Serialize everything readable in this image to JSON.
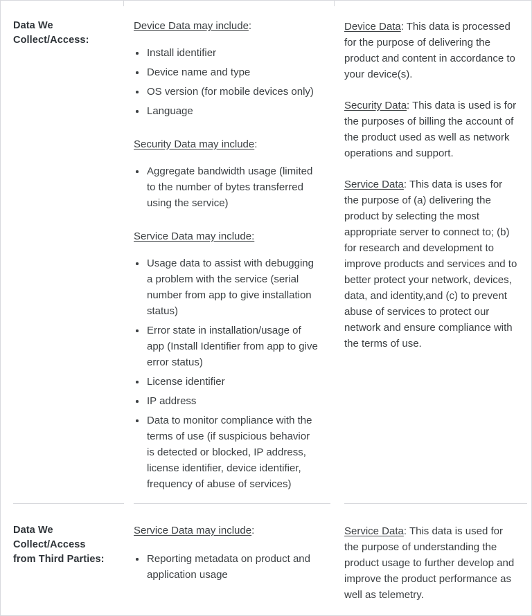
{
  "table": {
    "rows": [
      {
        "label": "Data We Collect/Access:",
        "label_lines": [
          "Data We",
          "Collect/Access:"
        ],
        "collect_sections": [
          {
            "heading_underlined": "Device Data may include",
            "heading_tail": ":",
            "items": [
              "Install identifier",
              "Device name and type",
              "OS version (for mobile devices only)",
              "Language"
            ]
          },
          {
            "heading_underlined": "Security Data may include",
            "heading_tail": ":",
            "items": [
              "Aggregate bandwidth usage (limited to the number of bytes transferred using the service)"
            ]
          },
          {
            "heading_underlined": "Service Data may include:",
            "heading_tail": "",
            "items": [
              "Usage data to assist with debugging a problem with the service (serial number from app to give installation status)",
              "Error state in installation/usage of app (Install Identifier from app to give error status)",
              "License identifier",
              "IP address",
              "Data to monitor compliance with the terms of use (if suspicious behavior is detected or blocked, IP address, license identifier, device identifier, frequency of abuse of services)"
            ]
          }
        ],
        "purpose_paragraphs": [
          {
            "term": "Device Data",
            "body": ": This data is processed for the purpose of delivering the product and content in accordance to your device(s)."
          },
          {
            "term": "Security Data",
            "body": ": This data is used is for the purposes of billing the account of the product used as well as network operations and support."
          },
          {
            "term": "Service Data",
            "body": ": This data is uses for the purpose of (a) delivering the product by selecting the most appropriate server to connect to; (b) for research and development to improve products and services and to better protect your network, devices, data, and identity,and (c) to prevent abuse of services to protect our network and ensure compliance with the terms of use."
          }
        ]
      },
      {
        "label": "Data We Collect/Access from Third Parties:",
        "label_lines": [
          "Data We",
          "Collect/Access",
          "from Third Parties:"
        ],
        "collect_sections": [
          {
            "heading_underlined": "Service Data may include",
            "heading_tail": ":",
            "items": [
              "Reporting metadata on product and application usage"
            ]
          }
        ],
        "purpose_paragraphs": [
          {
            "term": "Service Data",
            "body": ": This data is used for the purpose of understanding the product usage to further develop and improve the product performance as well as telemetry."
          }
        ]
      }
    ]
  },
  "colors": {
    "text": "#3c4043",
    "label_text": "#2e3338",
    "border": "#d8d9dd",
    "background": "#ffffff"
  }
}
